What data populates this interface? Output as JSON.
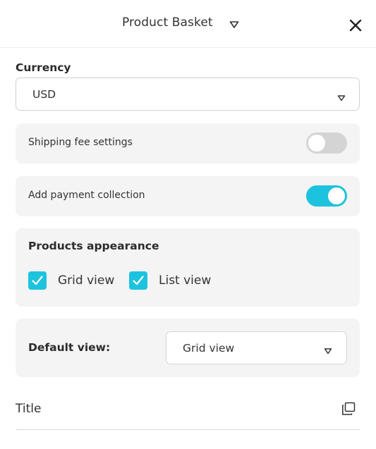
{
  "header": {
    "title": "Product Basket",
    "caret_icon": "triangle-down-icon",
    "close_icon": "close-icon"
  },
  "currency": {
    "label": "Currency",
    "value": "USD"
  },
  "shipping": {
    "label": "Shipping fee settings",
    "enabled": false
  },
  "payment": {
    "label": "Add payment collection",
    "enabled": true
  },
  "appearance": {
    "title": "Products appearance",
    "options": [
      {
        "label": "Grid view",
        "checked": true
      },
      {
        "label": "List view",
        "checked": true
      }
    ]
  },
  "default_view": {
    "label": "Default view:",
    "value": "Grid view"
  },
  "title_field": {
    "label": "Title",
    "action_icon": "copy-icon"
  },
  "colors": {
    "accent": "#1cc3de",
    "toggle_off": "#d4d4d4",
    "card_bg": "#f4f4f4"
  }
}
